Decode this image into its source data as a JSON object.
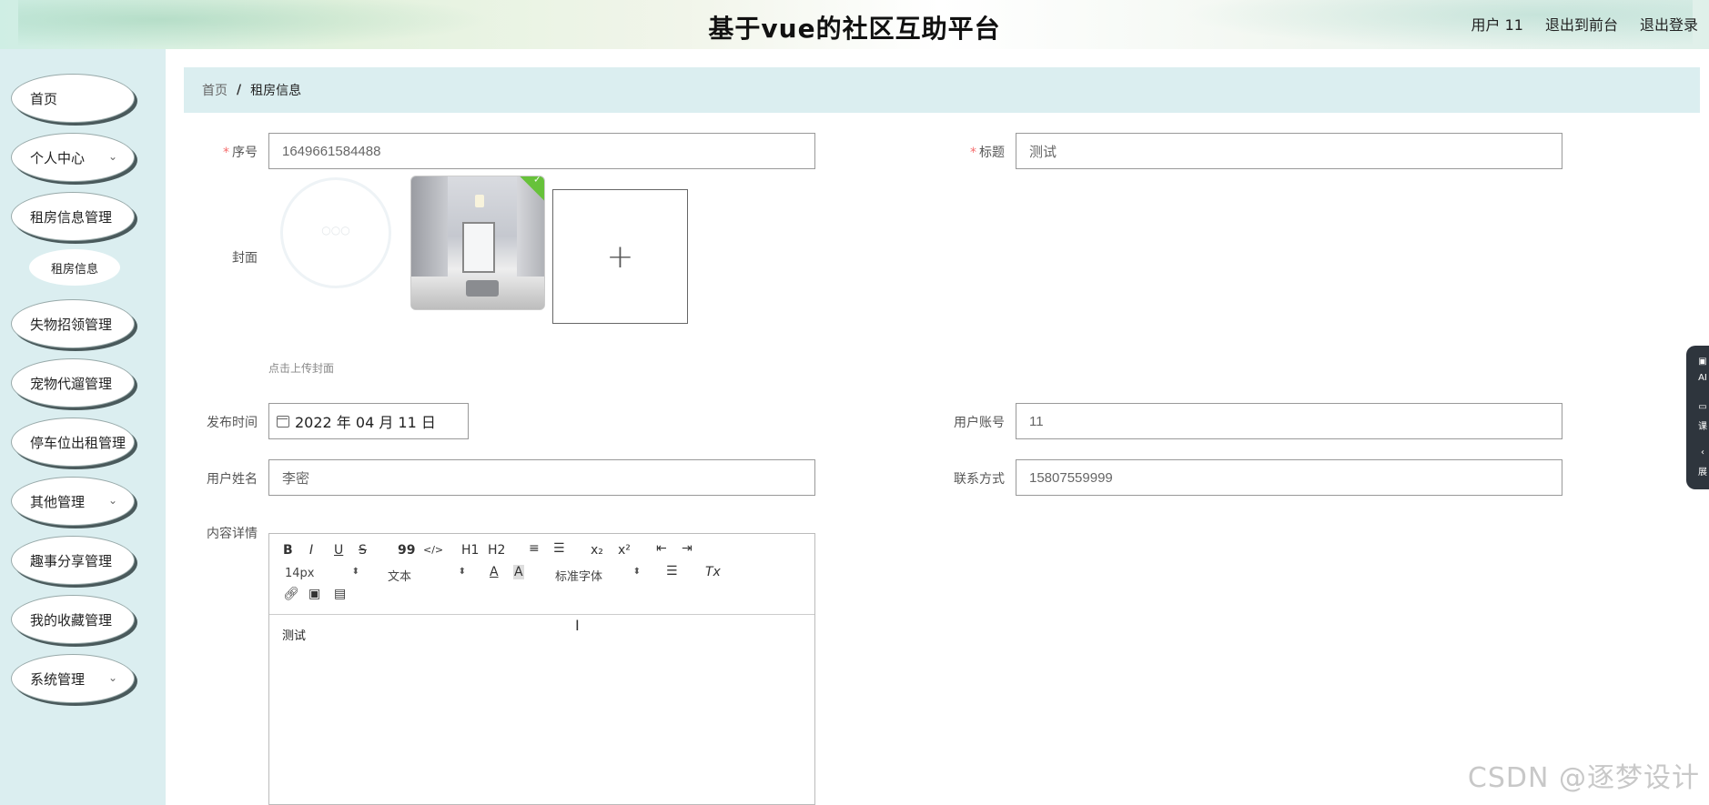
{
  "header": {
    "title": "基于vue的社区互助平台",
    "user": "用户 11",
    "back_front": "退出到前台",
    "logout": "退出登录"
  },
  "sidebar": {
    "items": [
      {
        "label": "首页",
        "has_chevron": false
      },
      {
        "label": "个人中心",
        "has_chevron": true
      },
      {
        "label": "租房信息管理",
        "has_chevron": false
      },
      {
        "label": "失物招领管理",
        "has_chevron": false
      },
      {
        "label": "宠物代遛管理",
        "has_chevron": false
      },
      {
        "label": "停车位出租管理",
        "has_chevron": false
      },
      {
        "label": "其他管理",
        "has_chevron": true
      },
      {
        "label": "趣事分享管理",
        "has_chevron": false
      },
      {
        "label": "我的收藏管理",
        "has_chevron": false
      },
      {
        "label": "系统管理",
        "has_chevron": true
      }
    ],
    "sub_item": "租房信息",
    "chevron": "chevron-down-icon"
  },
  "breadcrumb": {
    "home": "首页",
    "separator": "/",
    "current": "租房信息"
  },
  "form": {
    "serial_label": "序号",
    "serial_value": "1649661584488",
    "title_label": "标题",
    "title_value": "测试",
    "cover_label": "封面",
    "upload_plus": "+",
    "upload_hint": "点击上传封面",
    "publish_time_label": "发布时间",
    "publish_time_value": "2022 年 04 月 11 日",
    "account_label": "用户账号",
    "account_value": "11",
    "name_label": "用户姓名",
    "name_value": "李密",
    "contact_label": "联系方式",
    "contact_value": "15807559999",
    "content_label": "内容详情",
    "required_mark": "*"
  },
  "editor": {
    "bold": "B",
    "italic": "I",
    "underline": "U",
    "strike": "S",
    "quote": "99",
    "code": "</>",
    "h1": "H1",
    "h2": "H2",
    "sub": "x₂",
    "sup": "x²",
    "size_value": "14px",
    "header_value": "文本",
    "font_value": "标准字体",
    "clear": "Tx",
    "content": "测试"
  },
  "float_panel": {
    "item1": "AI",
    "item2": "课",
    "item3": "展"
  },
  "watermark": "CSDN @逐梦设计",
  "colors": {
    "sidebar_bg": "#dbeef0",
    "required": "#f56c6c",
    "upload_success": "#67c23a"
  }
}
